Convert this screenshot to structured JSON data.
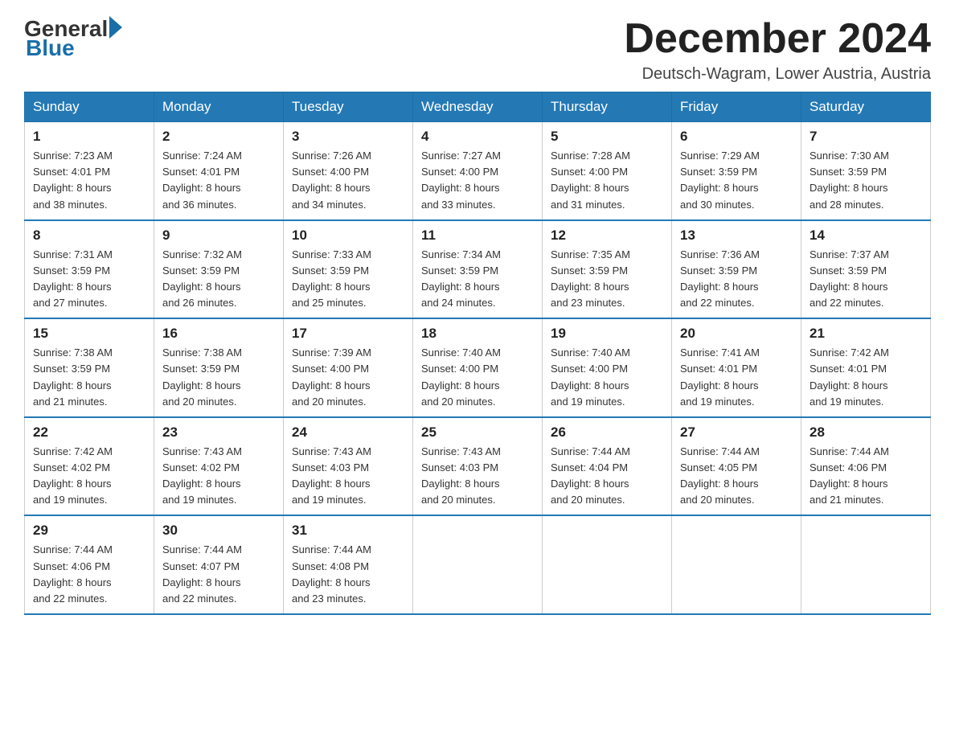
{
  "logo": {
    "general": "General",
    "blue": "Blue",
    "arrow": "▶"
  },
  "title": "December 2024",
  "location": "Deutsch-Wagram, Lower Austria, Austria",
  "weekdays": [
    "Sunday",
    "Monday",
    "Tuesday",
    "Wednesday",
    "Thursday",
    "Friday",
    "Saturday"
  ],
  "weeks": [
    [
      {
        "day": "1",
        "sunrise": "7:23 AM",
        "sunset": "4:01 PM",
        "daylight": "8 hours and 38 minutes."
      },
      {
        "day": "2",
        "sunrise": "7:24 AM",
        "sunset": "4:01 PM",
        "daylight": "8 hours and 36 minutes."
      },
      {
        "day": "3",
        "sunrise": "7:26 AM",
        "sunset": "4:00 PM",
        "daylight": "8 hours and 34 minutes."
      },
      {
        "day": "4",
        "sunrise": "7:27 AM",
        "sunset": "4:00 PM",
        "daylight": "8 hours and 33 minutes."
      },
      {
        "day": "5",
        "sunrise": "7:28 AM",
        "sunset": "4:00 PM",
        "daylight": "8 hours and 31 minutes."
      },
      {
        "day": "6",
        "sunrise": "7:29 AM",
        "sunset": "3:59 PM",
        "daylight": "8 hours and 30 minutes."
      },
      {
        "day": "7",
        "sunrise": "7:30 AM",
        "sunset": "3:59 PM",
        "daylight": "8 hours and 28 minutes."
      }
    ],
    [
      {
        "day": "8",
        "sunrise": "7:31 AM",
        "sunset": "3:59 PM",
        "daylight": "8 hours and 27 minutes."
      },
      {
        "day": "9",
        "sunrise": "7:32 AM",
        "sunset": "3:59 PM",
        "daylight": "8 hours and 26 minutes."
      },
      {
        "day": "10",
        "sunrise": "7:33 AM",
        "sunset": "3:59 PM",
        "daylight": "8 hours and 25 minutes."
      },
      {
        "day": "11",
        "sunrise": "7:34 AM",
        "sunset": "3:59 PM",
        "daylight": "8 hours and 24 minutes."
      },
      {
        "day": "12",
        "sunrise": "7:35 AM",
        "sunset": "3:59 PM",
        "daylight": "8 hours and 23 minutes."
      },
      {
        "day": "13",
        "sunrise": "7:36 AM",
        "sunset": "3:59 PM",
        "daylight": "8 hours and 22 minutes."
      },
      {
        "day": "14",
        "sunrise": "7:37 AM",
        "sunset": "3:59 PM",
        "daylight": "8 hours and 22 minutes."
      }
    ],
    [
      {
        "day": "15",
        "sunrise": "7:38 AM",
        "sunset": "3:59 PM",
        "daylight": "8 hours and 21 minutes."
      },
      {
        "day": "16",
        "sunrise": "7:38 AM",
        "sunset": "3:59 PM",
        "daylight": "8 hours and 20 minutes."
      },
      {
        "day": "17",
        "sunrise": "7:39 AM",
        "sunset": "4:00 PM",
        "daylight": "8 hours and 20 minutes."
      },
      {
        "day": "18",
        "sunrise": "7:40 AM",
        "sunset": "4:00 PM",
        "daylight": "8 hours and 20 minutes."
      },
      {
        "day": "19",
        "sunrise": "7:40 AM",
        "sunset": "4:00 PM",
        "daylight": "8 hours and 19 minutes."
      },
      {
        "day": "20",
        "sunrise": "7:41 AM",
        "sunset": "4:01 PM",
        "daylight": "8 hours and 19 minutes."
      },
      {
        "day": "21",
        "sunrise": "7:42 AM",
        "sunset": "4:01 PM",
        "daylight": "8 hours and 19 minutes."
      }
    ],
    [
      {
        "day": "22",
        "sunrise": "7:42 AM",
        "sunset": "4:02 PM",
        "daylight": "8 hours and 19 minutes."
      },
      {
        "day": "23",
        "sunrise": "7:43 AM",
        "sunset": "4:02 PM",
        "daylight": "8 hours and 19 minutes."
      },
      {
        "day": "24",
        "sunrise": "7:43 AM",
        "sunset": "4:03 PM",
        "daylight": "8 hours and 19 minutes."
      },
      {
        "day": "25",
        "sunrise": "7:43 AM",
        "sunset": "4:03 PM",
        "daylight": "8 hours and 20 minutes."
      },
      {
        "day": "26",
        "sunrise": "7:44 AM",
        "sunset": "4:04 PM",
        "daylight": "8 hours and 20 minutes."
      },
      {
        "day": "27",
        "sunrise": "7:44 AM",
        "sunset": "4:05 PM",
        "daylight": "8 hours and 20 minutes."
      },
      {
        "day": "28",
        "sunrise": "7:44 AM",
        "sunset": "4:06 PM",
        "daylight": "8 hours and 21 minutes."
      }
    ],
    [
      {
        "day": "29",
        "sunrise": "7:44 AM",
        "sunset": "4:06 PM",
        "daylight": "8 hours and 22 minutes."
      },
      {
        "day": "30",
        "sunrise": "7:44 AM",
        "sunset": "4:07 PM",
        "daylight": "8 hours and 22 minutes."
      },
      {
        "day": "31",
        "sunrise": "7:44 AM",
        "sunset": "4:08 PM",
        "daylight": "8 hours and 23 minutes."
      },
      null,
      null,
      null,
      null
    ]
  ],
  "labels": {
    "sunrise": "Sunrise:",
    "sunset": "Sunset:",
    "daylight": "Daylight:"
  }
}
